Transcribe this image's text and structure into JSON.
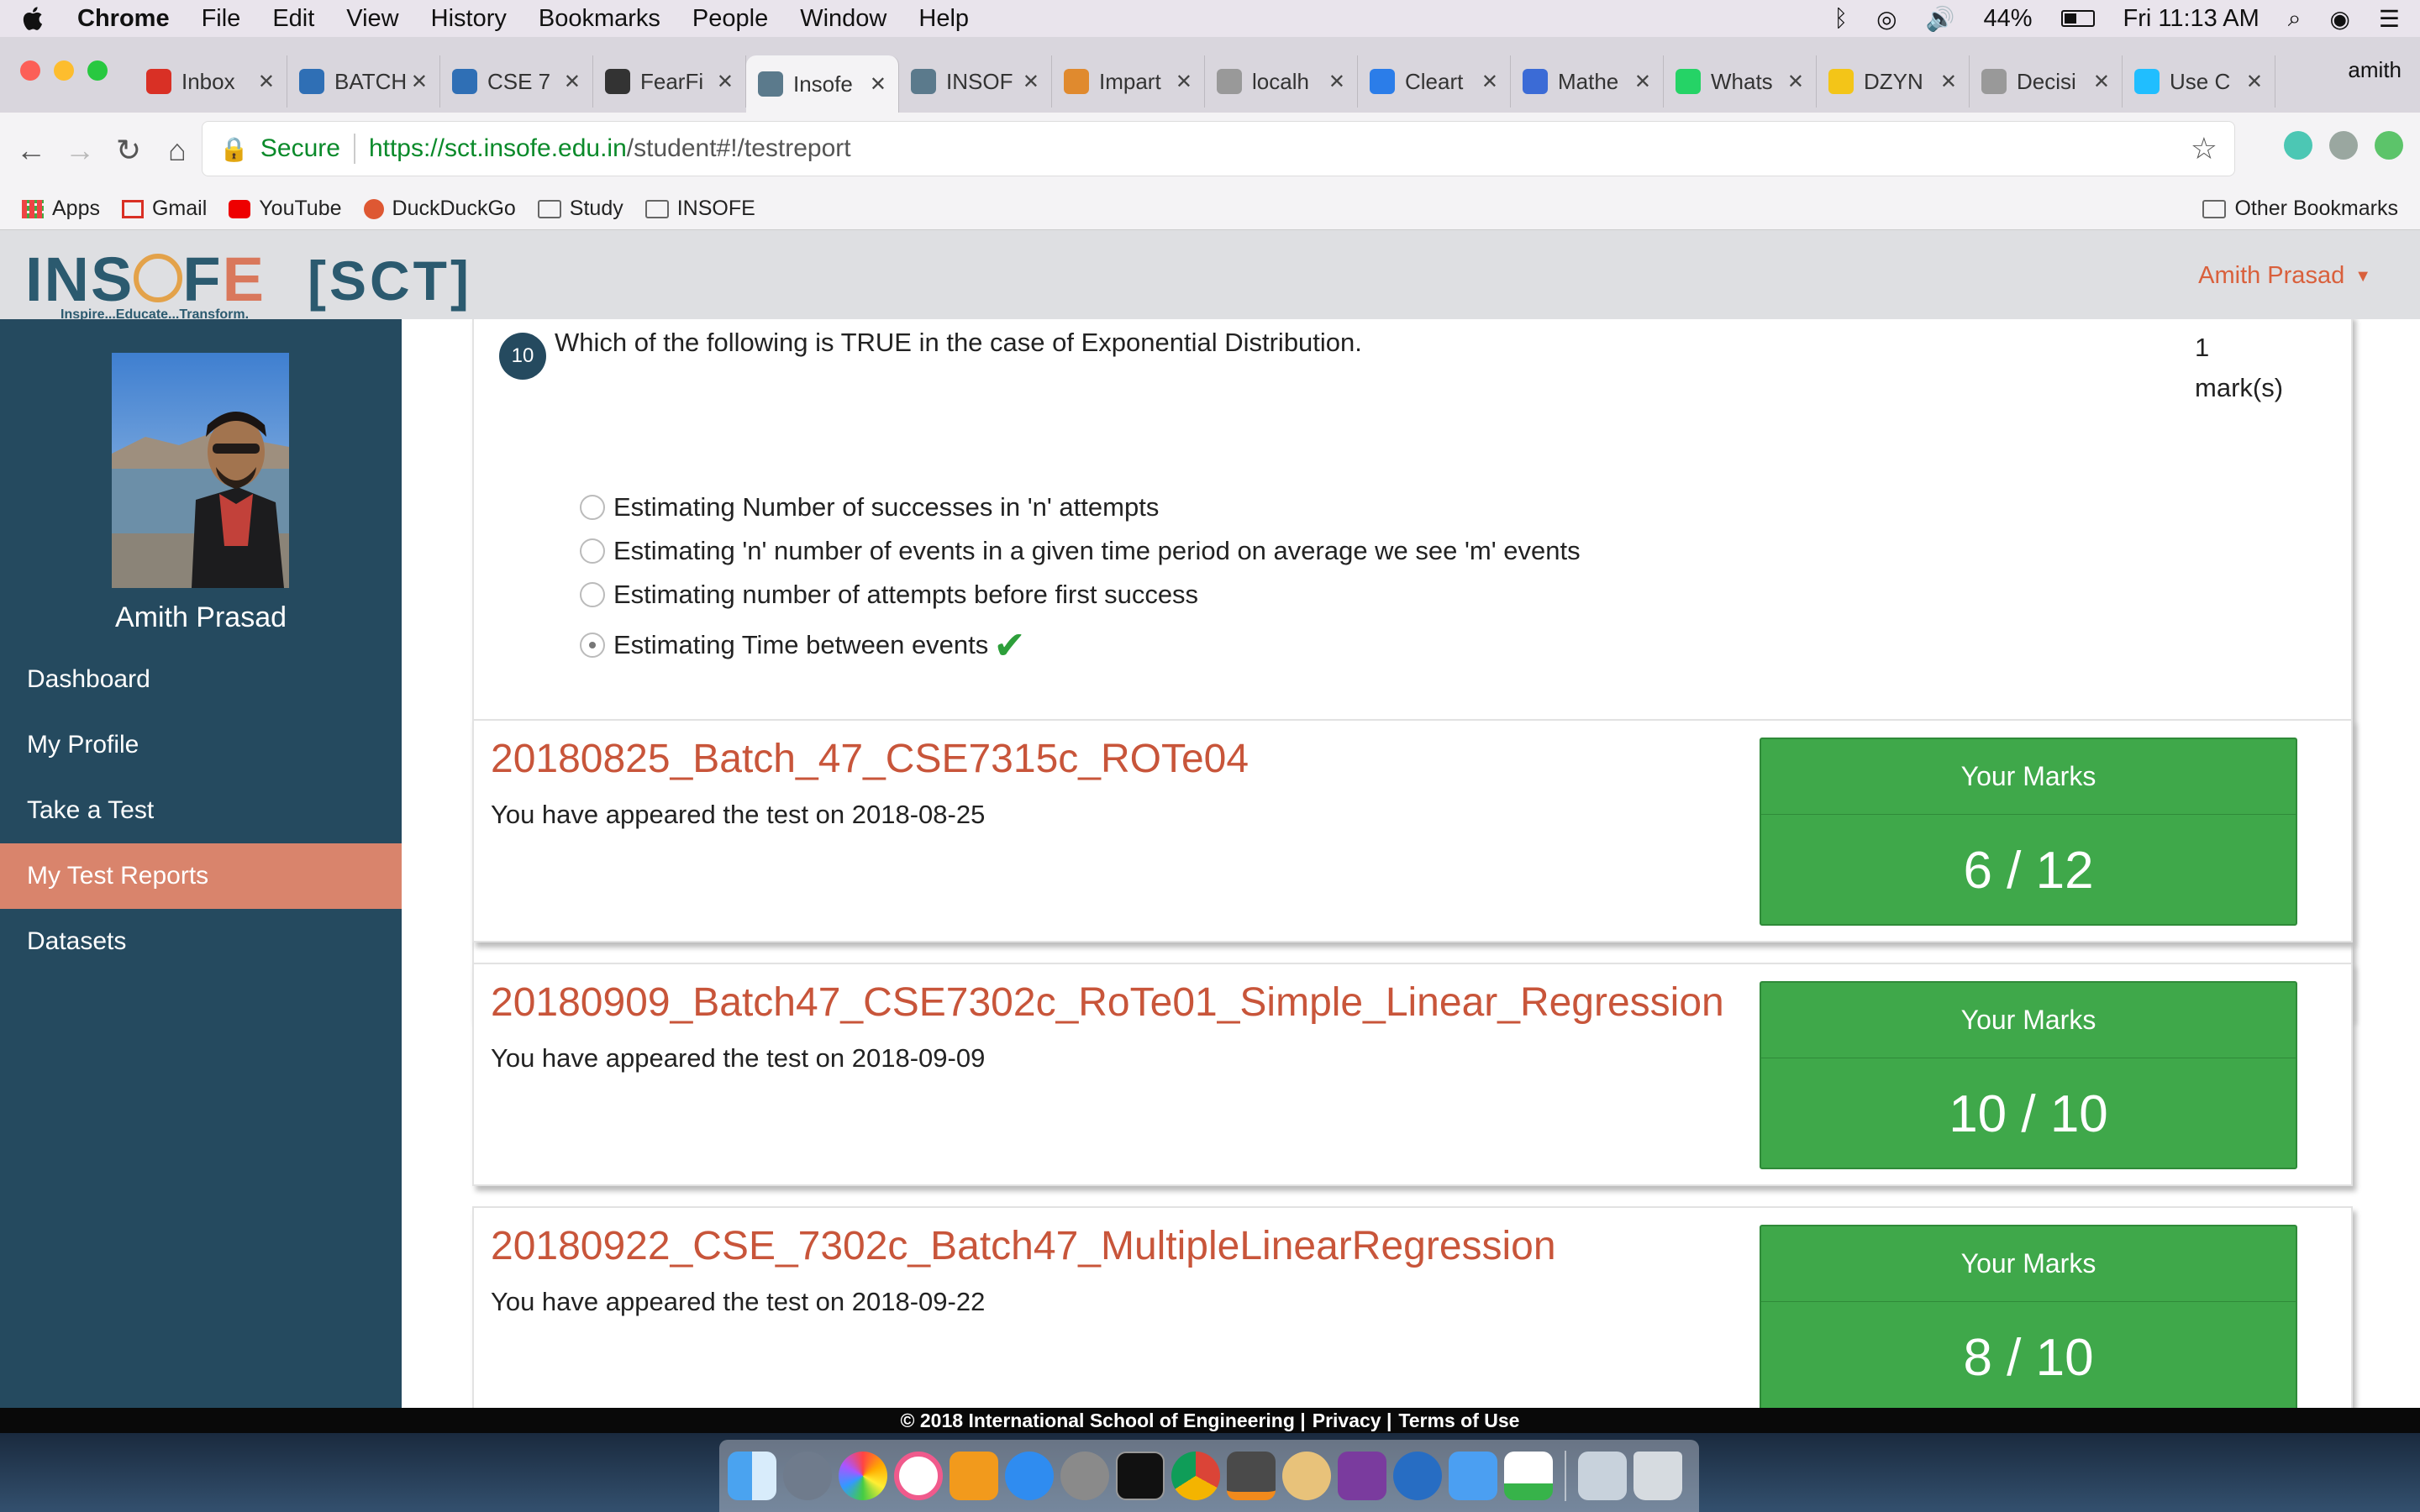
{
  "menubar": {
    "apple": "",
    "items": [
      "Chrome",
      "File",
      "Edit",
      "View",
      "History",
      "Bookmarks",
      "People",
      "Window",
      "Help"
    ],
    "battery": "44%",
    "clock": "Fri 11:13 AM"
  },
  "browser": {
    "profile": "amith",
    "tabs": [
      {
        "label": "Inbox",
        "icon": "gmail-icon",
        "color": "#d93025"
      },
      {
        "label": "BATCH",
        "icon": "p-icon",
        "color": "#2f6fb5"
      },
      {
        "label": "CSE 7",
        "icon": "p-icon",
        "color": "#2f6fb5"
      },
      {
        "label": "FearFi",
        "icon": "github-icon",
        "color": "#333333"
      },
      {
        "label": "Insofe",
        "icon": "insofe-icon",
        "color": "#5b7a8c",
        "active": true
      },
      {
        "label": "INSOF",
        "icon": "insofe-icon",
        "color": "#5b7a8c"
      },
      {
        "label": "Impart",
        "icon": "impart-icon",
        "color": "#e08a2e"
      },
      {
        "label": "localh",
        "icon": "page-icon",
        "color": "#999999"
      },
      {
        "label": "Cleart",
        "icon": "cleartax-icon",
        "color": "#2b7de9"
      },
      {
        "label": "Mathe",
        "icon": "infinity-icon",
        "color": "#3b6bd6"
      },
      {
        "label": "Whats",
        "icon": "whatsapp-icon",
        "color": "#25d366"
      },
      {
        "label": "DZYN",
        "icon": "dzyn-icon",
        "color": "#f3c518"
      },
      {
        "label": "Decisi",
        "icon": "page-icon",
        "color": "#999999"
      },
      {
        "label": "Use C",
        "icon": "kaggle-icon",
        "color": "#20beff"
      }
    ],
    "address": {
      "secure_label": "Secure",
      "url_host": "https://sct.insofe.edu.in",
      "url_path": "/student#!/testreport"
    },
    "bookmarks": [
      {
        "label": "Apps",
        "icon": "apps-grid-icon"
      },
      {
        "label": "Gmail",
        "icon": "gmail-icon"
      },
      {
        "label": "YouTube",
        "icon": "youtube-icon"
      },
      {
        "label": "DuckDuckGo",
        "icon": "duckduckgo-icon"
      },
      {
        "label": "Study",
        "icon": "folder-icon"
      },
      {
        "label": "INSOFE",
        "icon": "folder-icon"
      }
    ],
    "other_bookmarks": "Other Bookmarks"
  },
  "header": {
    "logo_text_before": "INS",
    "logo_text_after": "F",
    "logo_e": "E",
    "logo_tagline": "Inspire...Educate...Transform.",
    "sct": "[SCT]",
    "user_name": "Amith Prasad"
  },
  "sidebar": {
    "user_name": "Amith Prasad",
    "items": [
      {
        "label": "Dashboard"
      },
      {
        "label": "My Profile"
      },
      {
        "label": "Take a Test"
      },
      {
        "label": "My Test Reports",
        "active": true
      },
      {
        "label": "Datasets"
      }
    ]
  },
  "question": {
    "number": "10",
    "text": "Which of the following is TRUE in the case of Exponential Distribution.",
    "marks_value": "1",
    "marks_unit": "mark(s)",
    "options": [
      {
        "text": "Estimating Number of successes in 'n' attempts",
        "selected": false
      },
      {
        "text": "Estimating 'n' number of events in a given time period on average we see 'm' events",
        "selected": false
      },
      {
        "text": "Estimating number of attempts before first success",
        "selected": false
      },
      {
        "text": "Estimating Time between events",
        "selected": true,
        "correct_mark": "✔"
      }
    ]
  },
  "tests": [
    {
      "name": "20180825_Batch_47_CSE7315c_ROTe04",
      "date_text": "You have appeared the test on 2018-08-25",
      "marks_label": "Your Marks",
      "marks": "6 / 12"
    },
    {
      "name": "20180909_Batch47_CSE7302c_RoTe01_Simple_Linear_Regression",
      "date_text": "You have appeared the test on 2018-09-09",
      "marks_label": "Your Marks",
      "marks": "10 / 10"
    },
    {
      "name": "20180922_CSE_7302c_Batch47_MultipleLinearRegression",
      "date_text": "You have appeared the test on 2018-09-22",
      "marks_label": "Your Marks",
      "marks": "8 / 10"
    }
  ],
  "footer": {
    "copyright": "© 2018 International School of Engineering |",
    "privacy": "Privacy |",
    "terms": "Terms of Use"
  },
  "colors": {
    "sidebar": "#254a5f",
    "active_nav": "#d9846c",
    "test_title": "#c8553a",
    "marks_box": "#3fa84a"
  }
}
